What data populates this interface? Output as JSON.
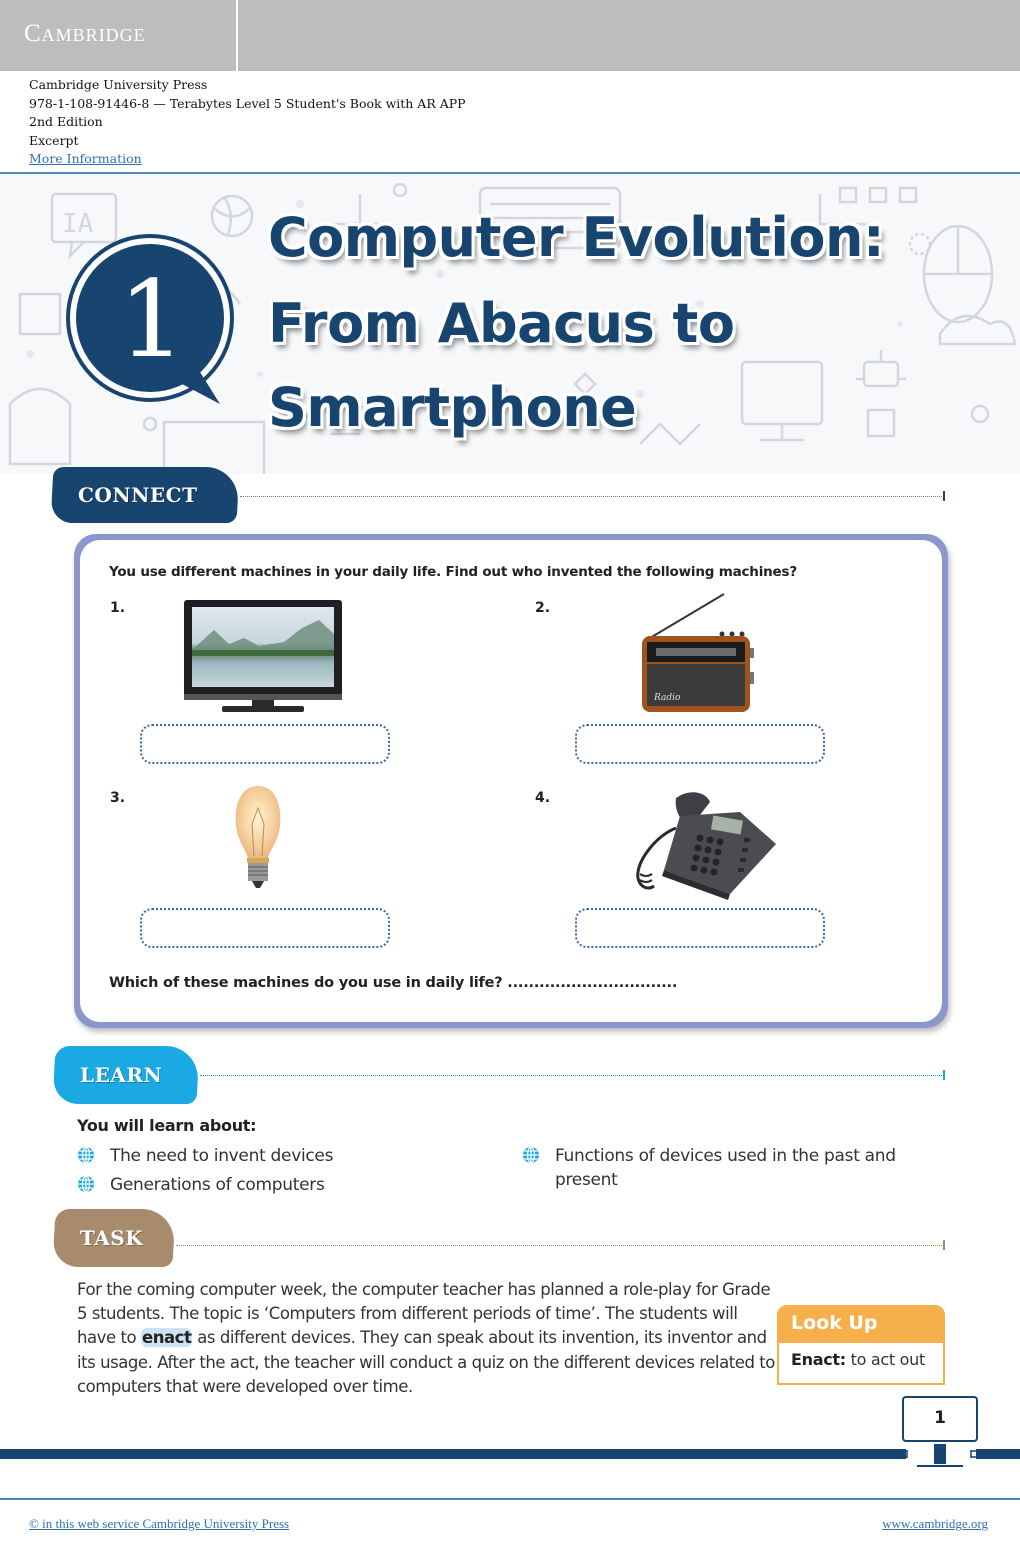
{
  "header": {
    "brand": "Cambridge",
    "publisher": "Cambridge University Press",
    "isbn_title": "978-1-108-91446-8 — Terabytes Level 5 Student's Book with AR APP",
    "edition": "2nd Edition",
    "excerpt": "Excerpt",
    "more_info_link": "More Information"
  },
  "chapter": {
    "number": "1",
    "title_lines": [
      "Computer Evolution:",
      "From Abacus to",
      "Smartphone"
    ]
  },
  "connect": {
    "label": "CONNECT",
    "question": "You use different machines in your daily life. Find out who invented the following machines?",
    "items": [
      {
        "num": "1.",
        "device": "television-image",
        "answer": ""
      },
      {
        "num": "2.",
        "device": "radio-image",
        "answer": ""
      },
      {
        "num": "3.",
        "device": "light-bulb-image",
        "answer": ""
      },
      {
        "num": "4.",
        "device": "telephone-image",
        "answer": ""
      }
    ],
    "footer_question": "Which of these machines do you use in daily life? ................................"
  },
  "learn": {
    "label": "LEARN",
    "heading": "You will learn about:",
    "items": [
      "The need to invent devices",
      "Generations of computers",
      "Functions of devices used in the past and present"
    ],
    "bullet_icon": "globe-icon"
  },
  "task": {
    "label": "TASK",
    "text_before": "For the coming computer week, the computer teacher has planned a role-play for Grade 5 students. The topic is ‘Computers from different periods of time’. The students will have to ",
    "highlight": "enact",
    "text_after": " as different devices. They can speak about its invention, its inventor and its usage. After the act, the teacher will conduct a quiz on the different devices related to computers that were developed over time."
  },
  "lookup": {
    "title": "Look Up",
    "term": "Enact:",
    "definition": " to act out"
  },
  "page_number": "1",
  "footer": {
    "copyright_link": "© in this web service Cambridge University Press",
    "site_link": "www.cambridge.org"
  },
  "colors": {
    "navy": "#184470",
    "learn_blue": "#1aa9e3",
    "task_brown": "#a88b6c",
    "lookup_orange": "#f5b04c",
    "card_border": "#8b97cc",
    "link_blue": "#2f6fb4"
  }
}
